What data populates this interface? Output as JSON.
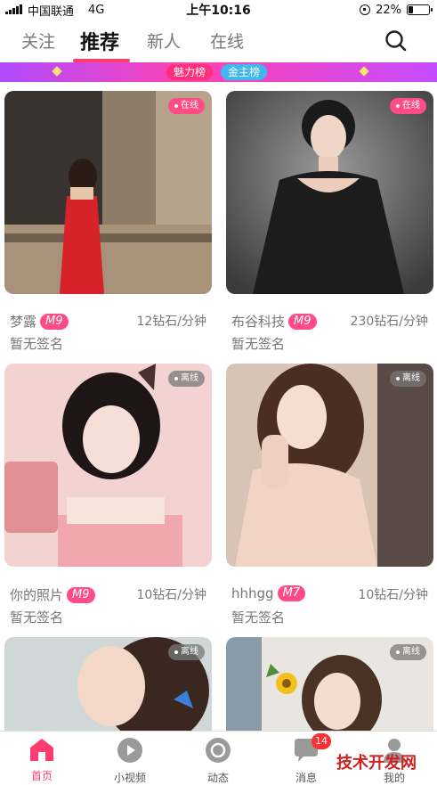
{
  "status_bar": {
    "carrier": "中国联通",
    "network": "4G",
    "time": "上午10:16",
    "battery_text": "22%",
    "battery_level": 0.22
  },
  "tabs": [
    {
      "label": "关注",
      "active": false
    },
    {
      "label": "推荐",
      "active": true
    },
    {
      "label": "新人",
      "active": false
    },
    {
      "label": "在线",
      "active": false
    }
  ],
  "banner": {
    "left_label": "魅力榜",
    "right_label": "金主榜"
  },
  "cards": [
    {
      "status": "在线",
      "name": "梦露",
      "level": "M9",
      "price": "12钻石/分钟",
      "signature": "暂无签名"
    },
    {
      "status": "在线",
      "name": "布谷科技",
      "level": "M9",
      "price": "230钻石/分钟",
      "signature": "暂无签名"
    },
    {
      "status": "离线",
      "name": "你的照片",
      "level": "M9",
      "price": "10钻石/分钟",
      "signature": "暂无签名"
    },
    {
      "status": "离线",
      "name": "hhhgg",
      "level": "M7",
      "price": "10钻石/分钟",
      "signature": "暂无签名"
    },
    {
      "status": "离线"
    },
    {
      "status": "离线"
    }
  ],
  "bottom_nav": [
    {
      "label": "首页",
      "icon": "home-icon",
      "active": true
    },
    {
      "label": "小视频",
      "icon": "play-icon",
      "active": false
    },
    {
      "label": "动态",
      "icon": "moments-icon",
      "active": false
    },
    {
      "label": "消息",
      "icon": "message-icon",
      "active": false,
      "badge": "14"
    },
    {
      "label": "我的",
      "icon": "profile-icon",
      "active": false
    }
  ],
  "watermark": "技术开发网",
  "colors": {
    "accent": "#ff3d6e",
    "level_badge": "#ff4b86",
    "online_badge": "#ff4b86",
    "offline_badge": "#808080"
  }
}
